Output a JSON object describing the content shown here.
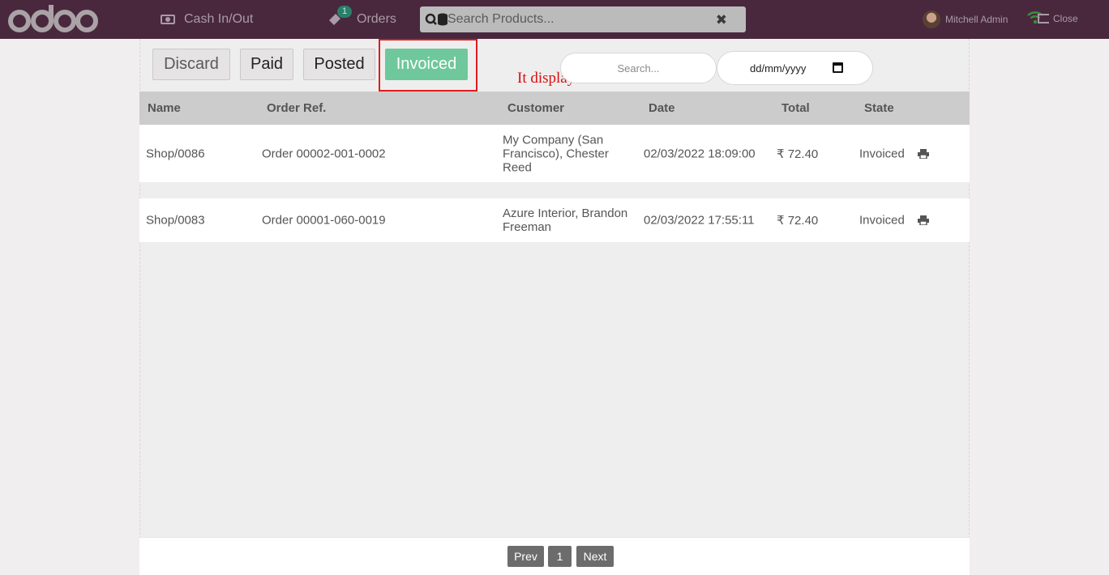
{
  "app": {
    "brand": "odoo"
  },
  "topbar": {
    "cash_label": "Cash In/Out",
    "orders_label": "Orders",
    "orders_badge": "1",
    "search_placeholder": "Search Products...",
    "user_name": "Mitchell Admin",
    "close_label": "Close"
  },
  "filters": {
    "discard": "Discard",
    "paid": "Paid",
    "posted": "Posted",
    "invoiced": "Invoiced",
    "active": "Invoiced"
  },
  "annotation": "It display all invoiced order.",
  "search": {
    "placeholder": "Search...",
    "date_placeholder": "dd/mm/yyyy"
  },
  "table": {
    "headers": [
      "Name",
      "Order Ref.",
      "Customer",
      "Date",
      "Total",
      "State"
    ],
    "rows": [
      {
        "name": "Shop/0086",
        "ref": "Order 00002-001-0002",
        "customer": "My Company (San Francisco), Chester Reed",
        "date": "02/03/2022 18:09:00",
        "total": "₹ 72.40",
        "state": "Invoiced"
      },
      {
        "name": "Shop/0083",
        "ref": "Order 00001-060-0019",
        "customer": "Azure Interior, Brandon Freeman",
        "date": "02/03/2022 17:55:11",
        "total": "₹ 72.40",
        "state": "Invoiced"
      }
    ]
  },
  "pager": {
    "prev": "Prev",
    "page": "1",
    "next": "Next"
  },
  "colors": {
    "topbar": "#49283e",
    "accent": "#6ec89b",
    "annotation": "#d90f0f"
  }
}
